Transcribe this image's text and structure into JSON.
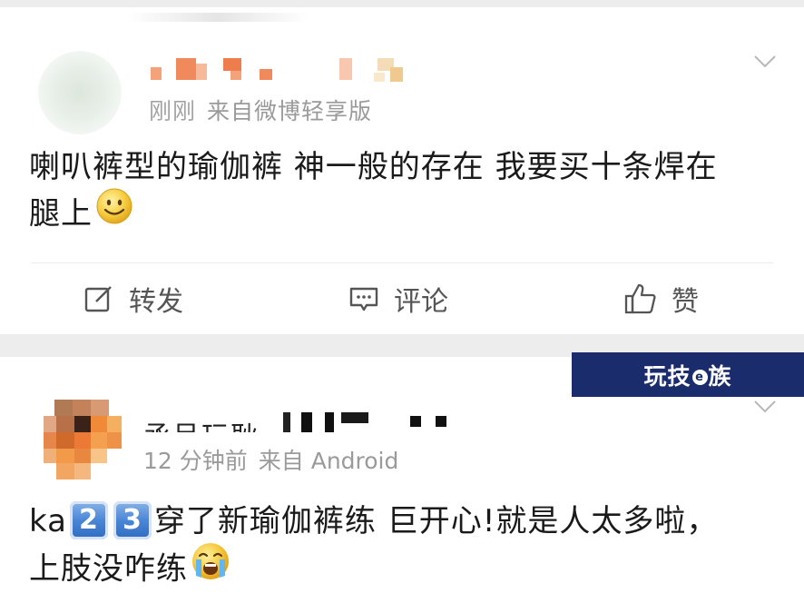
{
  "post1": {
    "time": "刚刚",
    "time_prefix_glyph": "刚",
    "source": "来自微博轻享版",
    "body_line1": "喇叭裤型的瑜伽裤 神一般的存在 我要买十条焊在",
    "body_line2": "腿上",
    "emoji": "smile-face",
    "actions": {
      "repost": "转发",
      "comment": "评论",
      "like": "赞"
    }
  },
  "watermark": {
    "part1": "玩技",
    "part2": "e",
    "part3": "族"
  },
  "post2": {
    "username_partial": "丞呈玩耿",
    "time": "12 分钟前",
    "source": "来自 Android",
    "body_prefix": "ka",
    "key1": "2",
    "key2": "3",
    "body_line1_rest": "穿了新瑜伽裤练 巨开心!就是人太多啦，",
    "body_line2": "上肢没咋练",
    "emoji2": "loudly-crying-face"
  },
  "colors": {
    "background": "#ededed",
    "card": "#ffffff",
    "meta_text": "#9a9a9a",
    "body_text": "#1a1a1a",
    "action_text": "#555555",
    "watermark_bg": "#1a2c6c"
  }
}
